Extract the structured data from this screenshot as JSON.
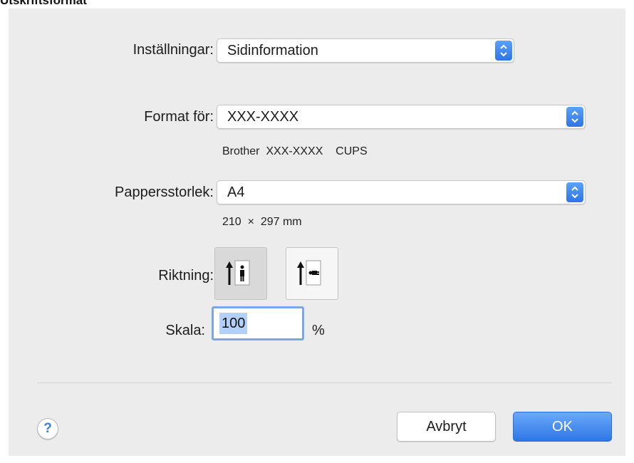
{
  "heading": "Utskriftsformat",
  "settings": {
    "label": "Inställningar:",
    "value": "Sidinformation"
  },
  "format_for": {
    "label": "Format för:",
    "value": "XXX-XXXX",
    "description": "Brother  XXX-XXXX    CUPS"
  },
  "paper_size": {
    "label": "Pappersstorlek:",
    "value": "A4",
    "dimensions": "210  ×  297 mm"
  },
  "orientation": {
    "label": "Riktning:",
    "selected": "portrait",
    "options": [
      "portrait",
      "landscape"
    ]
  },
  "scale": {
    "label": "Skala:",
    "value": "100",
    "unit": "%"
  },
  "buttons": {
    "help": "?",
    "cancel": "Avbryt",
    "ok": "OK"
  },
  "colors": {
    "accent": "#3478f6",
    "dialog_bg": "#ececec"
  }
}
